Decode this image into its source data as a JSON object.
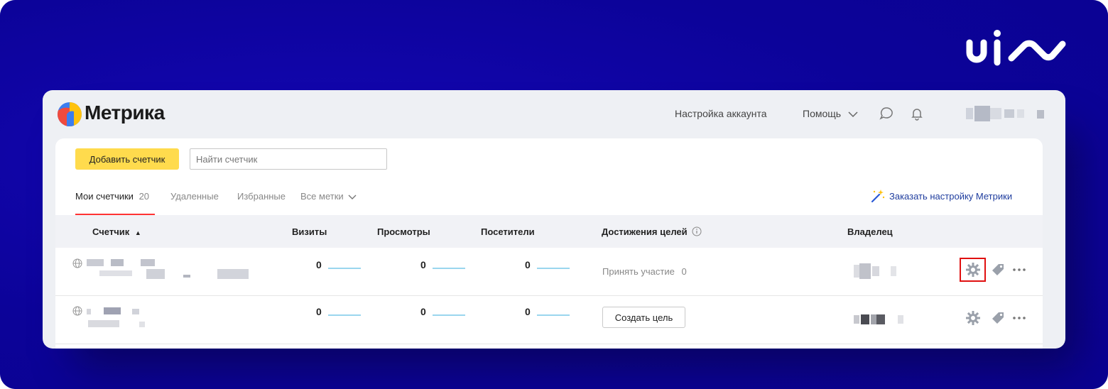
{
  "app": {
    "title": "Метрика"
  },
  "header": {
    "account_settings": "Настройка аккаунта",
    "help": "Помощь"
  },
  "toolbar": {
    "add_counter": "Добавить счетчик",
    "search_placeholder": "Найти счетчик"
  },
  "tabs": {
    "my_counters": "Мои счетчики",
    "my_counters_count": "20",
    "deleted": "Удаленные",
    "favorites": "Избранные",
    "all_tags": "Все метки"
  },
  "order_link": "Заказать настройку Метрики",
  "table": {
    "columns": {
      "counter": "Счетчик",
      "visits": "Визиты",
      "views": "Просмотры",
      "visitors": "Посетители",
      "goals": "Достижения целей",
      "owner": "Владелец"
    },
    "rows": [
      {
        "visits": "0",
        "views": "0",
        "visitors": "0",
        "goal_text": "Принять участие",
        "goal_count": "0"
      },
      {
        "visits": "0",
        "views": "0",
        "visitors": "0",
        "goal_button": "Создать цель"
      }
    ]
  },
  "colors": {
    "background": "#0c0399",
    "accent_yellow": "#ffdb4d",
    "active_tab": "#ff3333",
    "link_blue": "#1f3d9e",
    "highlight_red": "#e01010"
  }
}
